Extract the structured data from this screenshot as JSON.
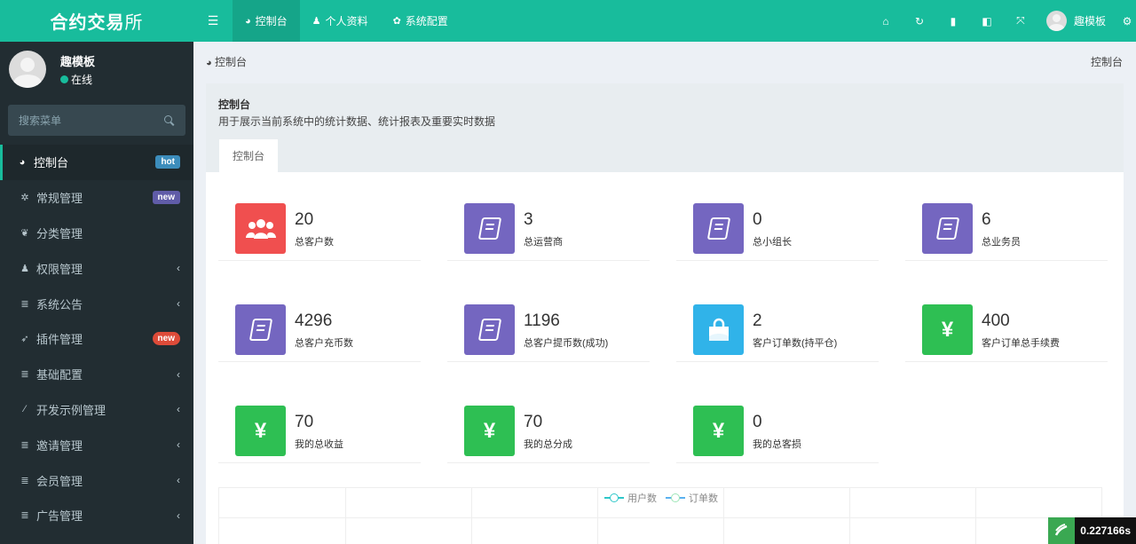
{
  "brand": {
    "main": "合约交易",
    "suffix": "所"
  },
  "user": {
    "name": "趣模板",
    "status": "在线"
  },
  "search": {
    "placeholder": "搜索菜单"
  },
  "sidebar": {
    "items": [
      {
        "label": "控制台",
        "icon": "dashboard-icon",
        "badge": "hot"
      },
      {
        "label": "常规管理",
        "icon": "cogs-icon",
        "badge": "new"
      },
      {
        "label": "分类管理",
        "icon": "leaf-icon"
      },
      {
        "label": "权限管理",
        "icon": "group-icon",
        "chevron": "‹"
      },
      {
        "label": "系统公告",
        "icon": "list-icon",
        "chevron": "‹"
      },
      {
        "label": "插件管理",
        "icon": "rocket-icon",
        "badge": "new"
      },
      {
        "label": "基础配置",
        "icon": "list-icon",
        "chevron": "‹"
      },
      {
        "label": "开发示例管理",
        "icon": "magic-icon",
        "chevron": "‹"
      },
      {
        "label": "邀请管理",
        "icon": "list-icon",
        "chevron": "‹"
      },
      {
        "label": "会员管理",
        "icon": "list-icon",
        "chevron": "‹"
      },
      {
        "label": "广告管理",
        "icon": "list-icon",
        "chevron": "‹"
      }
    ]
  },
  "header": {
    "tabs": [
      {
        "label": "控制台",
        "icon": "dashboard-icon"
      },
      {
        "label": "个人资料",
        "icon": "user-icon"
      },
      {
        "label": "系统配置",
        "icon": "cog-icon"
      }
    ],
    "user_name": "趣模板"
  },
  "breadcrumb": {
    "left": "控制台",
    "right": "控制台"
  },
  "panel": {
    "title": "控制台",
    "description": "用于展示当前系统中的统计数据、统计报表及重要实时数据",
    "tab": "控制台"
  },
  "stats": [
    {
      "value": "20",
      "label": "总客户数",
      "icon": "users-icon",
      "color": "#f04f4f"
    },
    {
      "value": "3",
      "label": "总运营商",
      "icon": "book-icon",
      "color": "#7466c0"
    },
    {
      "value": "0",
      "label": "总小组长",
      "icon": "book-icon",
      "color": "#7466c0"
    },
    {
      "value": "6",
      "label": "总业务员",
      "icon": "book-icon",
      "color": "#7466c0"
    },
    {
      "value": "4296",
      "label": "总客户充币数",
      "icon": "book-icon",
      "color": "#7466c0"
    },
    {
      "value": "1196",
      "label": "总客户提币数(成功)",
      "icon": "book-icon",
      "color": "#7466c0"
    },
    {
      "value": "2",
      "label": "客户订单数(持平仓)",
      "icon": "shopping-bag-icon",
      "color": "#30b3e9"
    },
    {
      "value": "400",
      "label": "客户订单总手续费",
      "icon": "yen-icon",
      "color": "#2ebf53"
    },
    {
      "value": "70",
      "label": "我的总收益",
      "icon": "yen-icon",
      "color": "#2ebf53"
    },
    {
      "value": "70",
      "label": "我的总分成",
      "icon": "yen-icon",
      "color": "#2ebf53"
    },
    {
      "value": "0",
      "label": "我的总客损",
      "icon": "yen-icon",
      "color": "#2ebf53"
    }
  ],
  "yen_symbol": "¥",
  "chart_legend": [
    "用户数",
    "订单数"
  ],
  "timer": "0.227166s"
}
